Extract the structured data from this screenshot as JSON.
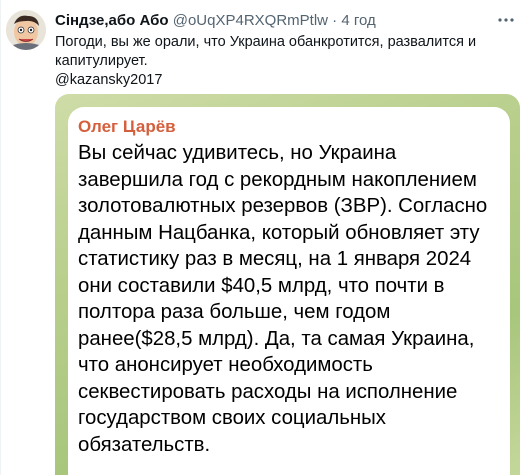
{
  "tweet": {
    "author_name": "Сіндзе,або Або",
    "handle": "@oUqXP4RXQRmPtlw",
    "separator": "·",
    "time": "4 год",
    "more_icon": "more-dots-icon",
    "text_line1": "Погоди, вы же орали, что Украина обанкротится, развалится и капитулирует.",
    "mention": "@kazansky2017"
  },
  "media": {
    "author": "Олег Царёв",
    "message": "Вы сейчас удивитесь, но Украина завершила год с рекордным накоплением золотовалютных резервов (ЗВР). Согласно данным Нацбанка, который обновляет эту статистику раз в месяц, на 1 января 2024 они составили $40,5 млрд, что почти в полтора раза больше, чем годом ранее($28,5 млрд). Да, та самая Украина, что анонсирует необходимость секвестировать расходы на исполнение государством своих социальных обязательств."
  }
}
